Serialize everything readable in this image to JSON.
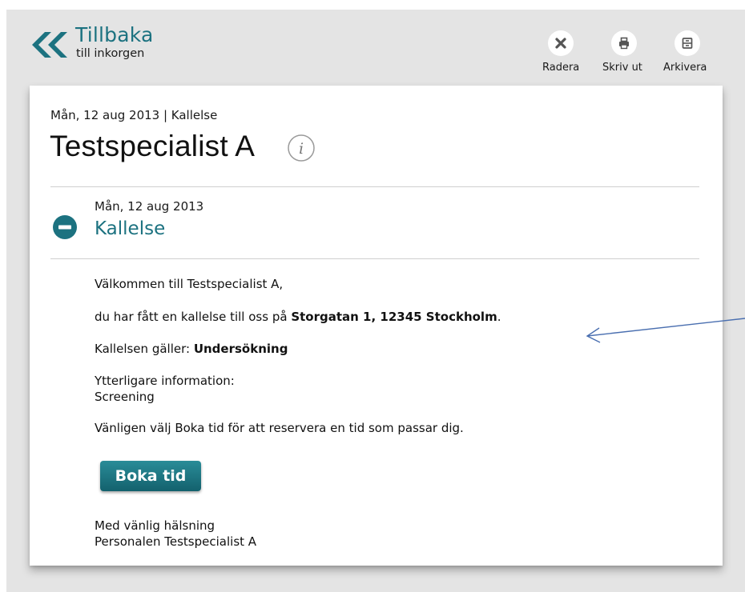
{
  "header": {
    "back_title": "Tillbaka",
    "back_subtitle": "till inkorgen",
    "back_icon": "double-chevron-left-icon",
    "accent_color": "#1c7280"
  },
  "toolbar": {
    "actions": [
      {
        "label": "Radera",
        "icon": "close-icon"
      },
      {
        "label": "Skriv ut",
        "icon": "printer-icon"
      },
      {
        "label": "Arkivera",
        "icon": "archive-icon"
      }
    ]
  },
  "message": {
    "meta": "Mån, 12 aug 2013 | Kallelse",
    "title": "Testspecialist A",
    "info_icon": "info-icon",
    "section": {
      "date": "Mån, 12 aug 2013",
      "title": "Kallelse",
      "toggle_icon": "collapse-minus-icon"
    },
    "body": {
      "greeting": "Välkommen till Testspecialist A,",
      "invite_prefix": "du har fått en kallelse till oss på ",
      "invite_address": "Storgatan 1, 12345 Stockholm",
      "invite_suffix": ".",
      "valid_prefix": "Kallelsen gäller: ",
      "valid_value": "Undersökning",
      "extra_label": "Ytterligare information:",
      "extra_value": "Screening",
      "instruction": "Vänligen välj Boka tid för att reservera en tid som passar dig.",
      "book_button": "Boka tid",
      "signoff": "Med vänlig hälsning",
      "signature": "Personalen Testspecialist A"
    }
  },
  "colors": {
    "background": "#e4e4e4",
    "card": "#ffffff",
    "button": "#1a7380",
    "annotation_arrow": "#4a6fb0"
  }
}
